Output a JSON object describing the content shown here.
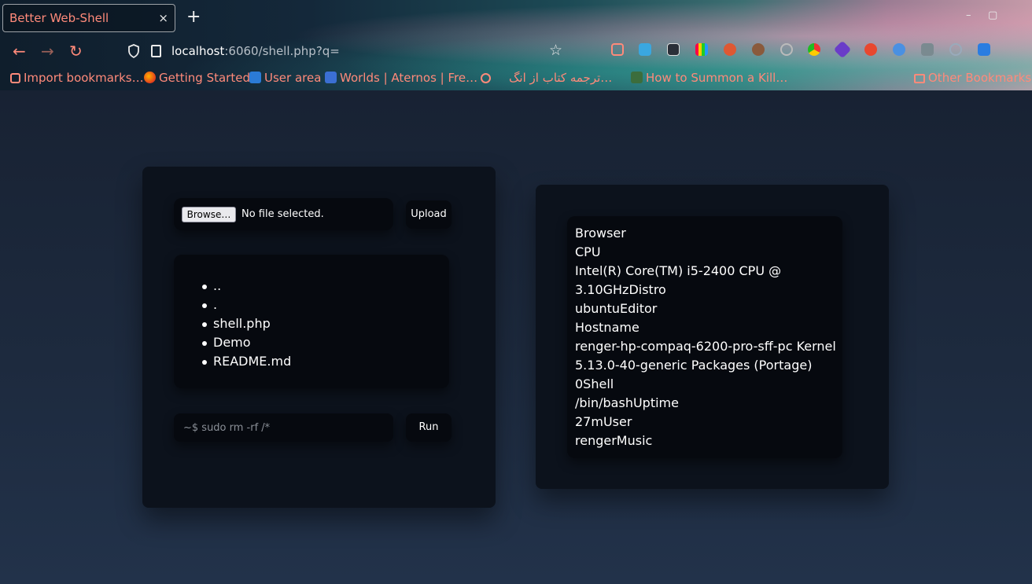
{
  "browser": {
    "tab_title": "Better Web-Shell",
    "tab_close": "×",
    "new_tab": "+",
    "url_host": "localhost",
    "url_rest": ":6060/shell.php?q=",
    "back": "←",
    "forward": "→",
    "reload": "↻",
    "star": "☆",
    "win_min": "–",
    "win_max": "▢",
    "bookmarks": [
      "Import bookmarks…",
      "Getting Started",
      "User area",
      "Worlds | Aternos | Fre…",
      "ترجمه کتاب از انگ…",
      "How to Summon a Kill…",
      "Other Bookmarks"
    ]
  },
  "upload": {
    "browse_label": "Browse…",
    "file_status": "No file selected.",
    "upload_label": "Upload"
  },
  "files": [
    "..",
    ".",
    "shell.php",
    "Demo",
    "README.md"
  ],
  "command": {
    "placeholder": "~$ sudo rm -rf /*",
    "run_label": "Run"
  },
  "system_info": [
    "Browser",
    "CPU",
    "Intel(R) Core(TM) i5-2400 CPU @",
    "3.10GHzDistro",
    "ubuntuEditor",
    "Hostname",
    "renger-hp-compaq-6200-pro-sff-pc Kernel",
    "5.13.0-40-generic Packages (Portage)",
    "0Shell",
    "/bin/bashUptime",
    "27mUser",
    "rengerMusic"
  ],
  "colors": {
    "accent": "#ff8a7a",
    "page_bg": "#1c2536",
    "panel_bg": "#0c121c",
    "card_bg": "#06090f"
  }
}
